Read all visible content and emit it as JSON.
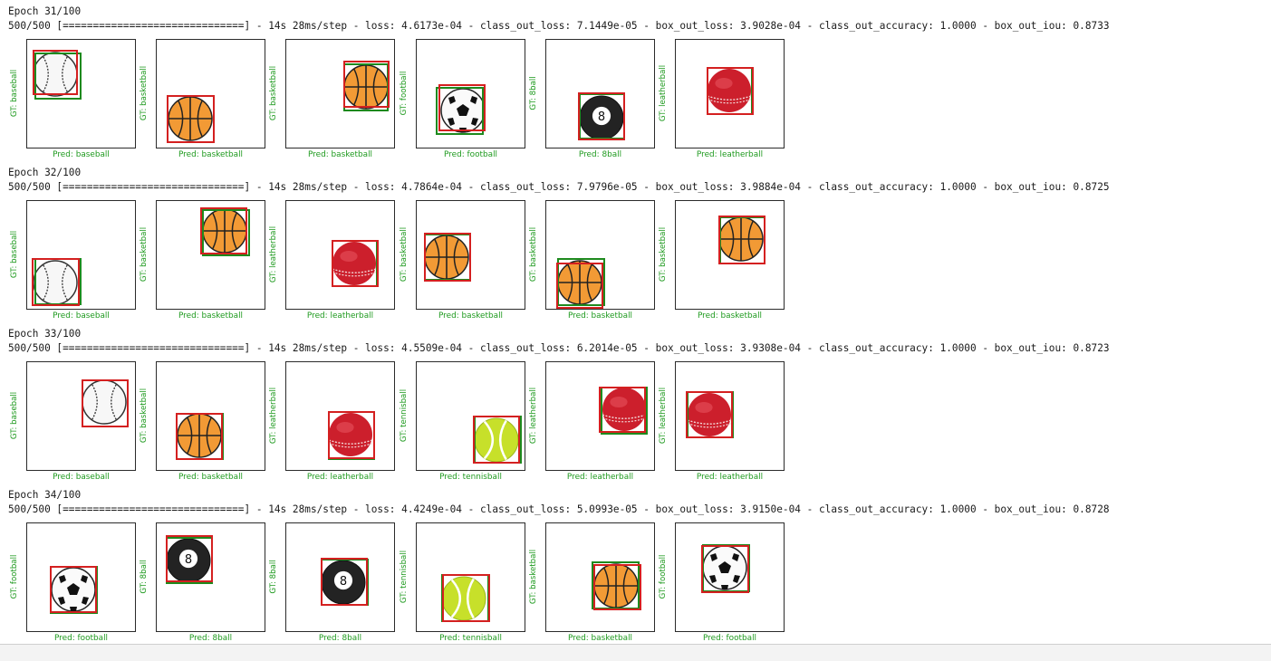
{
  "epochs": [
    {
      "epoch_text": "Epoch 31/100",
      "progress_text": "500/500 [==============================] - 14s 28ms/step - loss: 4.6173e-04 - class_out_loss: 7.1449e-05 - box_out_loss: 3.9028e-04 - class_out_accuracy: 1.0000 - box_out_iou: 0.8733",
      "samples": [
        {
          "gt": "GT: baseball",
          "pred": "Pred: baseball",
          "ball": "baseball"
        },
        {
          "gt": "GT: basketball",
          "pred": "Pred: basketball",
          "ball": "basketball"
        },
        {
          "gt": "GT: basketball",
          "pred": "Pred: basketball",
          "ball": "basketball"
        },
        {
          "gt": "GT: football",
          "pred": "Pred: football",
          "ball": "football"
        },
        {
          "gt": "GT: 8ball",
          "pred": "Pred: 8ball",
          "ball": "8ball"
        },
        {
          "gt": "GT: leatherball",
          "pred": "Pred: leatherball",
          "ball": "leatherball"
        }
      ]
    },
    {
      "epoch_text": "Epoch 32/100",
      "progress_text": "500/500 [==============================] - 14s 28ms/step - loss: 4.7864e-04 - class_out_loss: 7.9796e-05 - box_out_loss: 3.9884e-04 - class_out_accuracy: 1.0000 - box_out_iou: 0.8725",
      "samples": [
        {
          "gt": "GT: baseball",
          "pred": "Pred: baseball",
          "ball": "baseball"
        },
        {
          "gt": "GT: basketball",
          "pred": "Pred: basketball",
          "ball": "basketball"
        },
        {
          "gt": "GT: leatherball",
          "pred": "Pred: leatherball",
          "ball": "leatherball"
        },
        {
          "gt": "GT: basketball",
          "pred": "Pred: basketball",
          "ball": "basketball"
        },
        {
          "gt": "GT: basketball",
          "pred": "Pred: basketball",
          "ball": "basketball"
        },
        {
          "gt": "GT: basketball",
          "pred": "Pred: basketball",
          "ball": "basketball"
        }
      ]
    },
    {
      "epoch_text": "Epoch 33/100",
      "progress_text": "500/500 [==============================] - 14s 28ms/step - loss: 4.5509e-04 - class_out_loss: 6.2014e-05 - box_out_loss: 3.9308e-04 - class_out_accuracy: 1.0000 - box_out_iou: 0.8723",
      "samples": [
        {
          "gt": "GT: baseball",
          "pred": "Pred: baseball",
          "ball": "baseball"
        },
        {
          "gt": "GT: basketball",
          "pred": "Pred: basketball",
          "ball": "basketball"
        },
        {
          "gt": "GT: leatherball",
          "pred": "Pred: leatherball",
          "ball": "leatherball"
        },
        {
          "gt": "GT: tennisball",
          "pred": "Pred: tennisball",
          "ball": "tennisball"
        },
        {
          "gt": "GT: leatherball",
          "pred": "Pred: leatherball",
          "ball": "leatherball"
        },
        {
          "gt": "GT: leatherball",
          "pred": "Pred: leatherball",
          "ball": "leatherball"
        }
      ]
    },
    {
      "epoch_text": "Epoch 34/100",
      "progress_text": "500/500 [==============================] - 14s 28ms/step - loss: 4.4249e-04 - class_out_loss: 5.0993e-05 - box_out_loss: 3.9150e-04 - class_out_accuracy: 1.0000 - box_out_iou: 0.8728",
      "samples": [
        {
          "gt": "GT: football",
          "pred": "Pred: football",
          "ball": "football"
        },
        {
          "gt": "GT: 8ball",
          "pred": "Pred: 8ball",
          "ball": "8ball"
        },
        {
          "gt": "GT: 8ball",
          "pred": "Pred: 8ball",
          "ball": "8ball"
        },
        {
          "gt": "GT: tennisball",
          "pred": "Pred: tennisball",
          "ball": "tennisball"
        },
        {
          "gt": "GT: basketball",
          "pred": "Pred: basketball",
          "ball": "basketball"
        },
        {
          "gt": "GT: football",
          "pred": "Pred: football",
          "ball": "football"
        }
      ]
    }
  ],
  "colors": {
    "gt_box": "#1e8a1e",
    "pred_box": "#d42020",
    "label_text": "#1f9a1f",
    "console_text": "#1a1a1a"
  }
}
